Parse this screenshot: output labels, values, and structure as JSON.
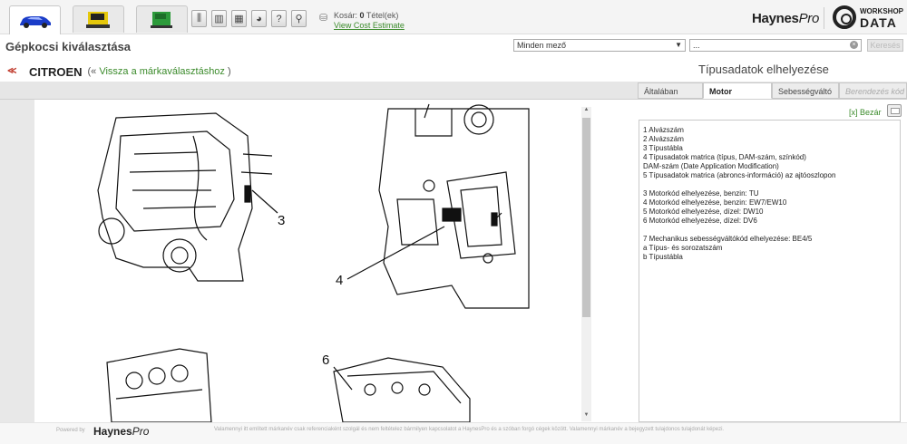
{
  "header": {
    "vehicle_tabs": [
      {
        "name": "car",
        "icon": "car-icon",
        "color": "#1a3cc8"
      },
      {
        "name": "truck",
        "icon": "truck-icon",
        "color": "#e5c80c"
      },
      {
        "name": "van",
        "icon": "van-icon",
        "color": "#2c9a3a"
      }
    ],
    "tools": [
      "tool-1-icon",
      "tool-2-icon",
      "calculator-icon",
      "gauge-icon",
      "help-icon",
      "search-icon"
    ],
    "cart_label": "Kosár:",
    "cart_count": "0",
    "cart_unit": "Tétel(ek)",
    "cost_link": "View Cost Estimate",
    "brand": "Haynes",
    "brand_suffix": "Pro",
    "wd_small": "WORKSHOP",
    "wd_big": "DATA"
  },
  "toolbar": {
    "page_title": "Gépkocsi kiválasztása",
    "field_select": "Minden mező",
    "search_value": "...",
    "search_button": "Keresés"
  },
  "make": {
    "name": "CITROEN",
    "back_prefix": "(«",
    "back_link": "Vissza a márkaválasztáshoz",
    "back_suffix": ")"
  },
  "panel": {
    "title": "Típusadatok elhelyezése",
    "tabs": [
      "Általában",
      "Motor",
      "Sebességváltó",
      "Berendezés kód"
    ],
    "active_tab": "Motor",
    "close": "[x] Bezár"
  },
  "callouts": [
    "3",
    "4",
    "6"
  ],
  "info_lines": [
    "1 Alvázszám",
    "2 Alvázszám",
    "3 Típustábla",
    "4 Típusadatok matrica (típus, DAM-szám, színkód)",
    "DAM-szám (Date Application Modification)",
    "5 Típusadatok matrica (abroncs-információ) az ajtóoszlopon",
    "",
    "3 Motorkód elhelyezése, benzin: TU",
    "4 Motorkód elhelyezése, benzin: EW7/EW10",
    "5 Motorkód elhelyezése, dízel: DW10",
    "6 Motorkód elhelyezése, dízel: DV6",
    "",
    "7 Mechanikus sebességváltókód elhelyezése: BE4/5",
    "a Típus- és sorozatszám",
    "b Típustábla"
  ],
  "footer": {
    "powered": "Powered by",
    "brand": "Haynes",
    "brand_suffix": "Pro",
    "disclaimer": "Valamennyi itt említett márkanév csak referenciaként szolgál és nem feltételez bármilyen kapcsolatot a HaynesPro és a szóban forgó cégek között. Valamennyi márkanév a bejegyzett tulajdonos tulajdonát képezi."
  }
}
